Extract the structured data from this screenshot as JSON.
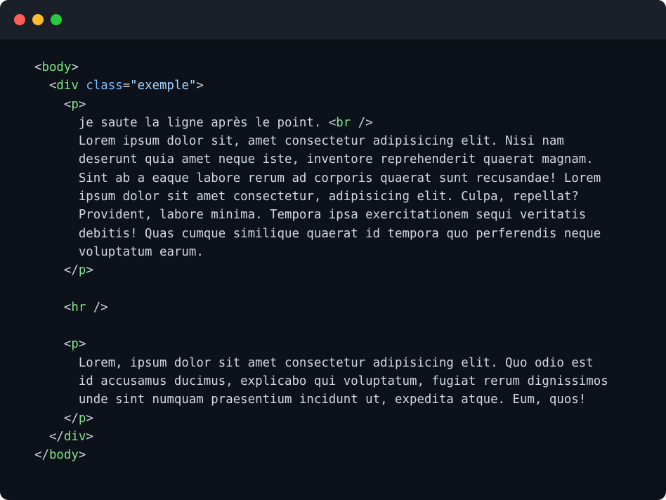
{
  "window": {
    "controls": {
      "close_color": "#ff5f57",
      "minimize_color": "#febc2e",
      "maximize_color": "#28c840"
    }
  },
  "code": {
    "lines": [
      [
        {
          "t": "punct",
          "v": "<"
        },
        {
          "t": "tag",
          "v": "body"
        },
        {
          "t": "punct",
          "v": ">"
        }
      ],
      [
        {
          "t": "punct",
          "v": "  <"
        },
        {
          "t": "tag",
          "v": "div"
        },
        {
          "t": "punct",
          "v": " "
        },
        {
          "t": "attr",
          "v": "class"
        },
        {
          "t": "punct",
          "v": "="
        },
        {
          "t": "str",
          "v": "\"exemple\""
        },
        {
          "t": "punct",
          "v": ">"
        }
      ],
      [
        {
          "t": "punct",
          "v": "    <"
        },
        {
          "t": "tag",
          "v": "p"
        },
        {
          "t": "punct",
          "v": ">"
        }
      ],
      [
        {
          "t": "txt",
          "v": "      je saute la ligne après le point. "
        },
        {
          "t": "punct",
          "v": "<"
        },
        {
          "t": "tag",
          "v": "br"
        },
        {
          "t": "punct",
          "v": " />"
        }
      ],
      [
        {
          "t": "txt",
          "v": "      Lorem ipsum dolor sit, amet consectetur adipisicing elit. Nisi nam"
        }
      ],
      [
        {
          "t": "txt",
          "v": "      deserunt quia amet neque iste, inventore reprehenderit quaerat magnam."
        }
      ],
      [
        {
          "t": "txt",
          "v": "      Sint ab a eaque labore rerum ad corporis quaerat sunt recusandae! Lorem"
        }
      ],
      [
        {
          "t": "txt",
          "v": "      ipsum dolor sit amet consectetur, adipisicing elit. Culpa, repellat?"
        }
      ],
      [
        {
          "t": "txt",
          "v": "      Provident, labore minima. Tempora ipsa exercitationem sequi veritatis"
        }
      ],
      [
        {
          "t": "txt",
          "v": "      debitis! Quas cumque similique quaerat id tempora quo perferendis neque"
        }
      ],
      [
        {
          "t": "txt",
          "v": "      voluptatum earum."
        }
      ],
      [
        {
          "t": "punct",
          "v": "    </"
        },
        {
          "t": "tag",
          "v": "p"
        },
        {
          "t": "punct",
          "v": ">"
        }
      ],
      [],
      [
        {
          "t": "punct",
          "v": "    <"
        },
        {
          "t": "tag",
          "v": "hr"
        },
        {
          "t": "punct",
          "v": " />"
        }
      ],
      [],
      [
        {
          "t": "punct",
          "v": "    <"
        },
        {
          "t": "tag",
          "v": "p"
        },
        {
          "t": "punct",
          "v": ">"
        }
      ],
      [
        {
          "t": "txt",
          "v": "      Lorem, ipsum dolor sit amet consectetur adipisicing elit. Quo odio est"
        }
      ],
      [
        {
          "t": "txt",
          "v": "      id accusamus ducimus, explicabo qui voluptatum, fugiat rerum dignissimos"
        }
      ],
      [
        {
          "t": "txt",
          "v": "      unde sint numquam praesentium incidunt ut, expedita atque. Eum, quos!"
        }
      ],
      [
        {
          "t": "punct",
          "v": "    </"
        },
        {
          "t": "tag",
          "v": "p"
        },
        {
          "t": "punct",
          "v": ">"
        }
      ],
      [
        {
          "t": "punct",
          "v": "  </"
        },
        {
          "t": "tag",
          "v": "div"
        },
        {
          "t": "punct",
          "v": ">"
        }
      ],
      [
        {
          "t": "punct",
          "v": "</"
        },
        {
          "t": "tag",
          "v": "body"
        },
        {
          "t": "punct",
          "v": ">"
        }
      ]
    ]
  }
}
